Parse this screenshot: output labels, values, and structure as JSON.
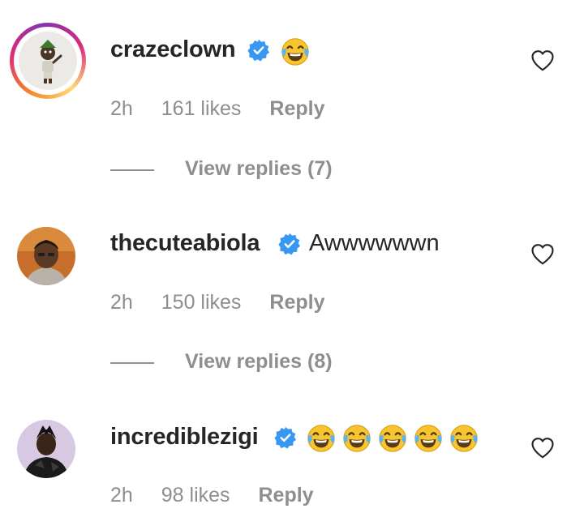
{
  "colors": {
    "text_primary": "#262626",
    "text_secondary": "#8e8e8e",
    "verified_blue": "#3897f0"
  },
  "comments": [
    {
      "username": "crazeclown",
      "verified": true,
      "text": "",
      "emojis": [
        "face-with-tears-of-joy"
      ],
      "time": "2h",
      "likes": "161 likes",
      "reply_label": "Reply",
      "view_replies": "View replies (7)",
      "has_story": true
    },
    {
      "username": "thecuteabiola",
      "verified": true,
      "text": "Awwwwwwn",
      "emojis": [],
      "time": "2h",
      "likes": "150 likes",
      "reply_label": "Reply",
      "view_replies": "View replies (8)",
      "has_story": false
    },
    {
      "username": "incrediblezigi",
      "verified": true,
      "text": "",
      "emojis": [
        "face-with-tears-of-joy",
        "face-with-tears-of-joy",
        "face-with-tears-of-joy",
        "face-with-tears-of-joy",
        "face-with-tears-of-joy"
      ],
      "time": "2h",
      "likes": "98 likes",
      "reply_label": "Reply",
      "has_story": false
    }
  ]
}
